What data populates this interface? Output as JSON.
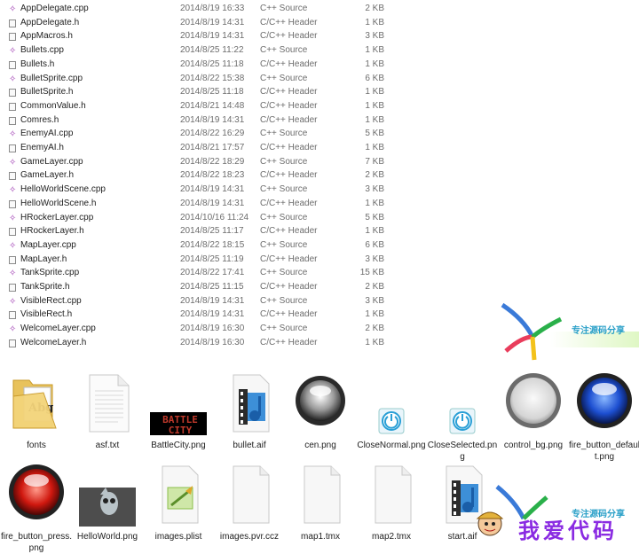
{
  "files": [
    {
      "name": "AppDelegate.cpp",
      "date": "2014/8/19 16:33",
      "type": "C++ Source",
      "size": "2 KB",
      "kind": "cpp"
    },
    {
      "name": "AppDelegate.h",
      "date": "2014/8/19 14:31",
      "type": "C/C++ Header",
      "size": "1 KB",
      "kind": "h"
    },
    {
      "name": "AppMacros.h",
      "date": "2014/8/19 14:31",
      "type": "C/C++ Header",
      "size": "3 KB",
      "kind": "h"
    },
    {
      "name": "Bullets.cpp",
      "date": "2014/8/25 11:22",
      "type": "C++ Source",
      "size": "1 KB",
      "kind": "cpp"
    },
    {
      "name": "Bullets.h",
      "date": "2014/8/25 11:18",
      "type": "C/C++ Header",
      "size": "1 KB",
      "kind": "h"
    },
    {
      "name": "BulletSprite.cpp",
      "date": "2014/8/22 15:38",
      "type": "C++ Source",
      "size": "6 KB",
      "kind": "cpp"
    },
    {
      "name": "BulletSprite.h",
      "date": "2014/8/25 11:18",
      "type": "C/C++ Header",
      "size": "1 KB",
      "kind": "h"
    },
    {
      "name": "CommonValue.h",
      "date": "2014/8/21 14:48",
      "type": "C/C++ Header",
      "size": "1 KB",
      "kind": "h"
    },
    {
      "name": "Comres.h",
      "date": "2014/8/19 14:31",
      "type": "C/C++ Header",
      "size": "1 KB",
      "kind": "h"
    },
    {
      "name": "EnemyAI.cpp",
      "date": "2014/8/22 16:29",
      "type": "C++ Source",
      "size": "5 KB",
      "kind": "cpp"
    },
    {
      "name": "EnemyAI.h",
      "date": "2014/8/21 17:57",
      "type": "C/C++ Header",
      "size": "1 KB",
      "kind": "h"
    },
    {
      "name": "GameLayer.cpp",
      "date": "2014/8/22 18:29",
      "type": "C++ Source",
      "size": "7 KB",
      "kind": "cpp"
    },
    {
      "name": "GameLayer.h",
      "date": "2014/8/22 18:23",
      "type": "C/C++ Header",
      "size": "2 KB",
      "kind": "h"
    },
    {
      "name": "HelloWorldScene.cpp",
      "date": "2014/8/19 14:31",
      "type": "C++ Source",
      "size": "3 KB",
      "kind": "cpp"
    },
    {
      "name": "HelloWorldScene.h",
      "date": "2014/8/19 14:31",
      "type": "C/C++ Header",
      "size": "1 KB",
      "kind": "h"
    },
    {
      "name": "HRockerLayer.cpp",
      "date": "2014/10/16 11:24",
      "type": "C++ Source",
      "size": "5 KB",
      "kind": "cpp"
    },
    {
      "name": "HRockerLayer.h",
      "date": "2014/8/25 11:17",
      "type": "C/C++ Header",
      "size": "1 KB",
      "kind": "h"
    },
    {
      "name": "MapLayer.cpp",
      "date": "2014/8/22 18:15",
      "type": "C++ Source",
      "size": "6 KB",
      "kind": "cpp"
    },
    {
      "name": "MapLayer.h",
      "date": "2014/8/25 11:19",
      "type": "C/C++ Header",
      "size": "3 KB",
      "kind": "h"
    },
    {
      "name": "TankSprite.cpp",
      "date": "2014/8/22 17:41",
      "type": "C++ Source",
      "size": "15 KB",
      "kind": "cpp"
    },
    {
      "name": "TankSprite.h",
      "date": "2014/8/25 11:15",
      "type": "C/C++ Header",
      "size": "2 KB",
      "kind": "h"
    },
    {
      "name": "VisibleRect.cpp",
      "date": "2014/8/19 14:31",
      "type": "C++ Source",
      "size": "3 KB",
      "kind": "cpp"
    },
    {
      "name": "VisibleRect.h",
      "date": "2014/8/19 14:31",
      "type": "C/C++ Header",
      "size": "1 KB",
      "kind": "h"
    },
    {
      "name": "WelcomeLayer.cpp",
      "date": "2014/8/19 16:30",
      "type": "C++ Source",
      "size": "2 KB",
      "kind": "cpp"
    },
    {
      "name": "WelcomeLayer.h",
      "date": "2014/8/19 16:30",
      "type": "C/C++ Header",
      "size": "1 KB",
      "kind": "h"
    }
  ],
  "items": [
    {
      "label": "fonts",
      "icon": "folder-icon"
    },
    {
      "label": "asf.txt",
      "icon": "text-file-icon"
    },
    {
      "label": "BattleCity.png",
      "icon": "battle-city-thumbnail",
      "art_text": "BATTLE CITY"
    },
    {
      "label": "bullet.aif",
      "icon": "audio-file-icon"
    },
    {
      "label": "cen.png",
      "icon": "silver-orb-thumbnail"
    },
    {
      "label": "CloseNormal.png",
      "icon": "power-button-thumbnail"
    },
    {
      "label": "CloseSelected.png",
      "icon": "power-button-thumbnail"
    },
    {
      "label": "control_bg.png",
      "icon": "silver-ring-thumbnail"
    },
    {
      "label": "fire_button_default.png",
      "icon": "blue-orb-thumbnail"
    },
    {
      "label": "fire_button_press.png",
      "icon": "red-orb-thumbnail"
    },
    {
      "label": "HelloWorld.png",
      "icon": "cocos-logo-thumbnail"
    },
    {
      "label": "images.plist",
      "icon": "plist-file-icon"
    },
    {
      "label": "images.pvr.ccz",
      "icon": "blank-file-icon"
    },
    {
      "label": "map1.tmx",
      "icon": "blank-file-icon"
    },
    {
      "label": "map2.tmx",
      "icon": "blank-file-icon"
    },
    {
      "label": "start.aif",
      "icon": "audio-file-icon"
    }
  ],
  "watermark": {
    "top_text": "专注源码分享",
    "bottom_text": "专注源码分享",
    "big_text": "我爱代码"
  },
  "colors": {
    "cpp_icon": "#a13fb4",
    "watermark_blue": "#2aa0c8",
    "watermark_purple": "#8a2be2"
  }
}
